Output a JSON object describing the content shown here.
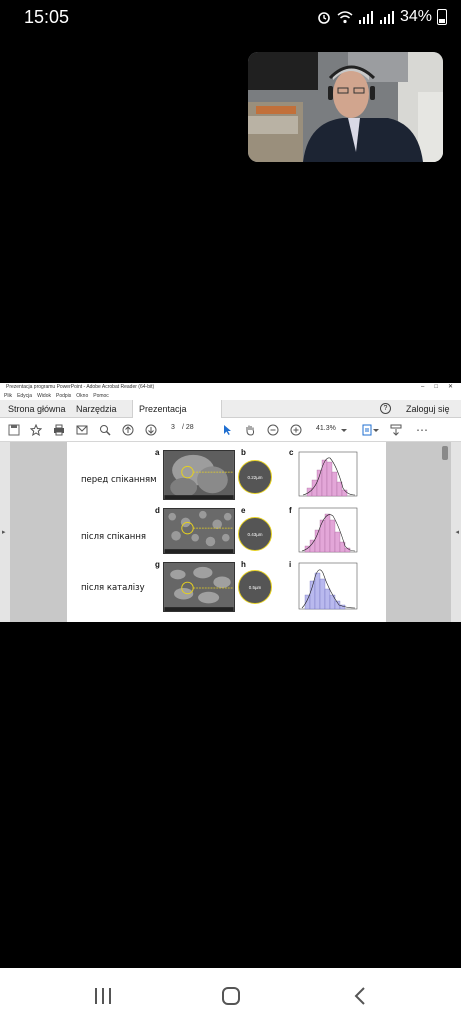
{
  "status": {
    "time": "15:05",
    "battery": "34%"
  },
  "acrobat": {
    "window_title": "Prezentacja programu PowerPoint - Adobe Acrobat Reader (64-bit)",
    "menu": [
      "Plik",
      "Edycja",
      "Widok",
      "Podpis",
      "Okno",
      "Pomoc"
    ],
    "tabs": {
      "home": "Strona główna",
      "tools": "Narzędzia",
      "doc": "Prezentacja progra...",
      "close": "×"
    },
    "help": "?",
    "login": "Zaloguj się",
    "page_current": "3",
    "page_total": "/ 28",
    "zoom": "41.3%"
  },
  "slide": {
    "rows": [
      {
        "label": "перед спіканням",
        "letters": [
          "a",
          "b",
          "c"
        ],
        "zoom_text": "0.22µm"
      },
      {
        "label": "після спікання",
        "letters": [
          "d",
          "e",
          "f"
        ],
        "zoom_text": "0.43µm"
      },
      {
        "label": "після каталізу",
        "letters": [
          "g",
          "h",
          "i"
        ],
        "zoom_text": "0.5µm"
      }
    ]
  },
  "colors": {
    "hist_pink": "#e3a6d8",
    "hist_blue": "#b9b9ee",
    "circle_yellow": "#e5d021"
  }
}
